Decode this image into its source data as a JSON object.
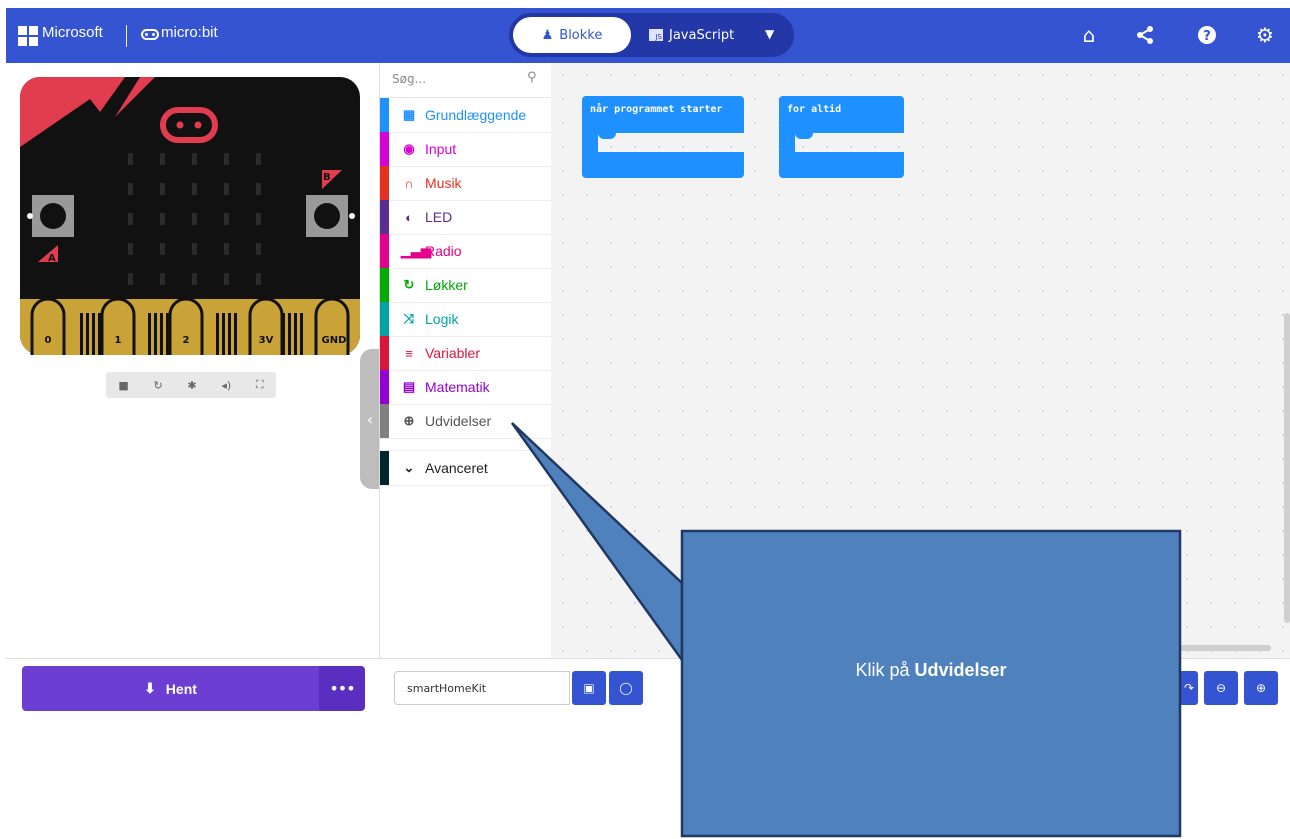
{
  "header": {
    "brand": "Microsoft",
    "product": "micro:bit",
    "tabs": {
      "blocks": "Blokke",
      "javascript": "JavaScript"
    },
    "icons": [
      "home-icon",
      "share-icon",
      "help-icon",
      "settings-icon"
    ]
  },
  "simulator": {
    "pins": [
      "0",
      "1",
      "2",
      "3V",
      "GND"
    ],
    "buttons": {
      "a": "A",
      "b": "B"
    }
  },
  "toolbox": {
    "search_placeholder": "Søg...",
    "categories": [
      {
        "label": "Grundlæggende",
        "color": "#1E90FF"
      },
      {
        "label": "Input",
        "color": "#D400D4"
      },
      {
        "label": "Musik",
        "color": "#E63022"
      },
      {
        "label": "LED",
        "color": "#5C2D91"
      },
      {
        "label": "Radio",
        "color": "#E3008C"
      },
      {
        "label": "Løkker",
        "color": "#00AA00"
      },
      {
        "label": "Logik",
        "color": "#00A4A6"
      },
      {
        "label": "Variabler",
        "color": "#DC143C"
      },
      {
        "label": "Matematik",
        "color": "#9400D3"
      },
      {
        "label": "Udvidelser",
        "color": "#808080"
      },
      {
        "label": "Avanceret",
        "color": "#00272B"
      }
    ]
  },
  "workspace": {
    "blocks": [
      {
        "label": "når programmet starter"
      },
      {
        "label": "for altid"
      }
    ]
  },
  "footer": {
    "download_label": "Hent",
    "more_label": "•••",
    "project_name": "smartHomeKit"
  },
  "callout": {
    "prefix": "Klik på ",
    "emphasis": "Udvidelser"
  },
  "colors": {
    "header": "#3454D1",
    "download": "#6c3ed1",
    "callout": "#4F81BD",
    "callout_border": "#1F3864"
  }
}
